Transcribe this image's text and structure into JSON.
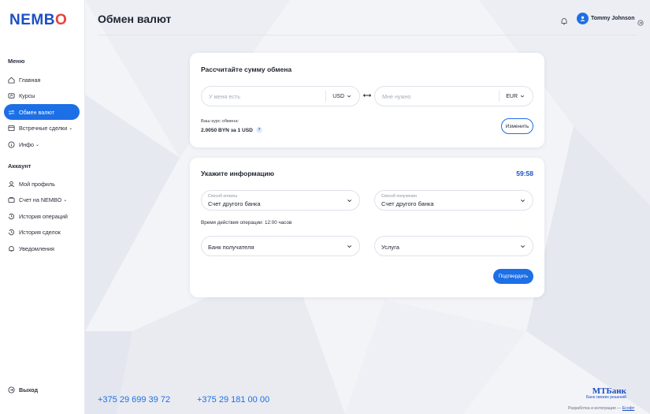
{
  "logo": {
    "text_main": "NEMB",
    "text_accent": "O"
  },
  "sidebar": {
    "menu_label": "Меню",
    "menu_items": [
      {
        "label": "Главная",
        "icon": "home-icon",
        "active": false
      },
      {
        "label": "Курсы",
        "icon": "rates-icon",
        "active": false
      },
      {
        "label": "Обмен валют",
        "icon": "exchange-icon",
        "active": true
      },
      {
        "label": "Встречные сделки",
        "icon": "deals-icon",
        "active": false,
        "has_submenu": true
      },
      {
        "label": "Инфо",
        "icon": "info-icon",
        "active": false,
        "has_submenu": true
      }
    ],
    "account_label": "Аккаунт",
    "account_items": [
      {
        "label": "Мой профиль",
        "icon": "user-icon"
      },
      {
        "label": "Счет на NEMBO",
        "icon": "account-icon",
        "has_submenu": true
      },
      {
        "label": "История операций",
        "icon": "history-icon"
      },
      {
        "label": "История сделок",
        "icon": "history-icon"
      },
      {
        "label": "Уведомления",
        "icon": "bell-icon"
      }
    ],
    "logout_label": "Выход"
  },
  "header": {
    "title": "Обмен валют",
    "user_name": "Tommy Johnson"
  },
  "calculator": {
    "title": "Рассчитайте сумму обмена",
    "have_placeholder": "У меня есть",
    "have_currency": "USD",
    "need_placeholder": "Мне нужно",
    "need_currency": "EUR",
    "rate_label": "Ваш курс обмена:",
    "rate_value": "2.0050 BYN за 1 USD",
    "help_mark": "?",
    "change_button": "Изменить"
  },
  "info_form": {
    "title": "Укажите информацию",
    "timer": "59:58",
    "payment_method_label": "Способ оплаты",
    "payment_method_value": "Счет другого банка",
    "receive_method_label": "Способ получения",
    "receive_method_value": "Счет другого банка",
    "validity_text": "Время действия операции: 12:00 часов",
    "recipient_bank": "Банк получателя",
    "service": "Услуга",
    "confirm_button": "Подтвердить"
  },
  "footer": {
    "phone1": "+375 29 699 39 72",
    "phone2": "+375 29 181 00 00",
    "bank_name": "МТБанк",
    "bank_tagline": "Банк свежих решений",
    "dev_text": "Разработка и интеграция —",
    "dev_link": "Есофт"
  },
  "colors": {
    "primary": "#1d6fe6",
    "brand_dark": "#1c4fc4",
    "accent_red": "#e8413e",
    "background": "#f3f4f8"
  }
}
